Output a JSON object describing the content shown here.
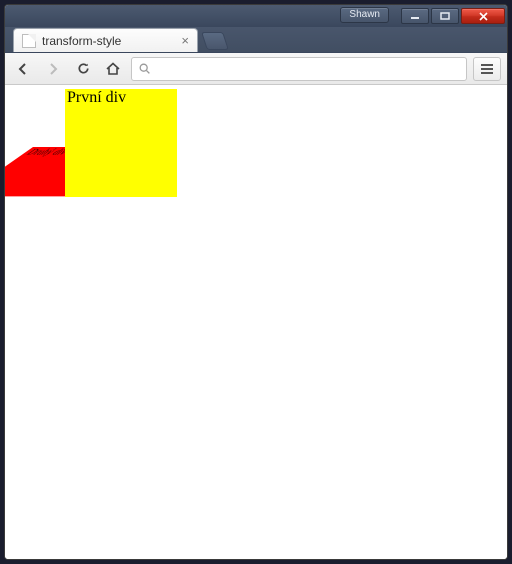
{
  "window": {
    "user": "Shawn"
  },
  "tab": {
    "title": "transform-style"
  },
  "omnibox": {
    "placeholder": ""
  },
  "page": {
    "div1_text": "První div",
    "div2_text": "Druhý div"
  }
}
